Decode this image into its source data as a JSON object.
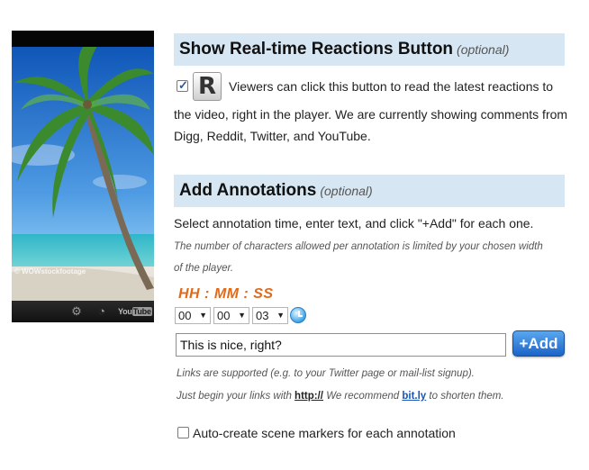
{
  "player": {
    "watermark": "© WOWstockfootage",
    "logo_you": "You",
    "logo_tube": "Tube"
  },
  "reactions": {
    "title": "Show Real-time Reactions Button",
    "optional": "(optional)",
    "checked": true,
    "button_letter": "R",
    "line1": "Viewers can click this button to read the latest reactions to",
    "line2": "the video, right in the player. We are currently showing comments from",
    "line3": "Digg, Reddit, Twitter, and YouTube."
  },
  "annotations": {
    "title": "Add Annotations",
    "optional": "(optional)",
    "instruction": "Select annotation time, enter text, and click \"+Add\" for each one.",
    "note1": "The number of characters allowed per annotation is limited by your chosen width",
    "note2": "of the player.",
    "time_label": "HH : MM : SS",
    "hours": "00",
    "minutes": "00",
    "seconds": "03",
    "input_value": "This is nice, right?",
    "add_label": "+Add",
    "links_note": "Links are supported (e.g. to your Twitter page or mail-list signup).",
    "links_begin": "Just begin your links with",
    "links_prefix": "http://",
    "links_recommend": "We recommend",
    "links_service": "bit.ly",
    "links_end": "to shorten them.",
    "auto_markers_label": "Auto-create scene markers for each annotation",
    "auto_markers_checked": false
  },
  "colors": {
    "header_bg": "#d6e6f2",
    "time_label": "#e06a1a",
    "add_button": "#1c63c7"
  }
}
